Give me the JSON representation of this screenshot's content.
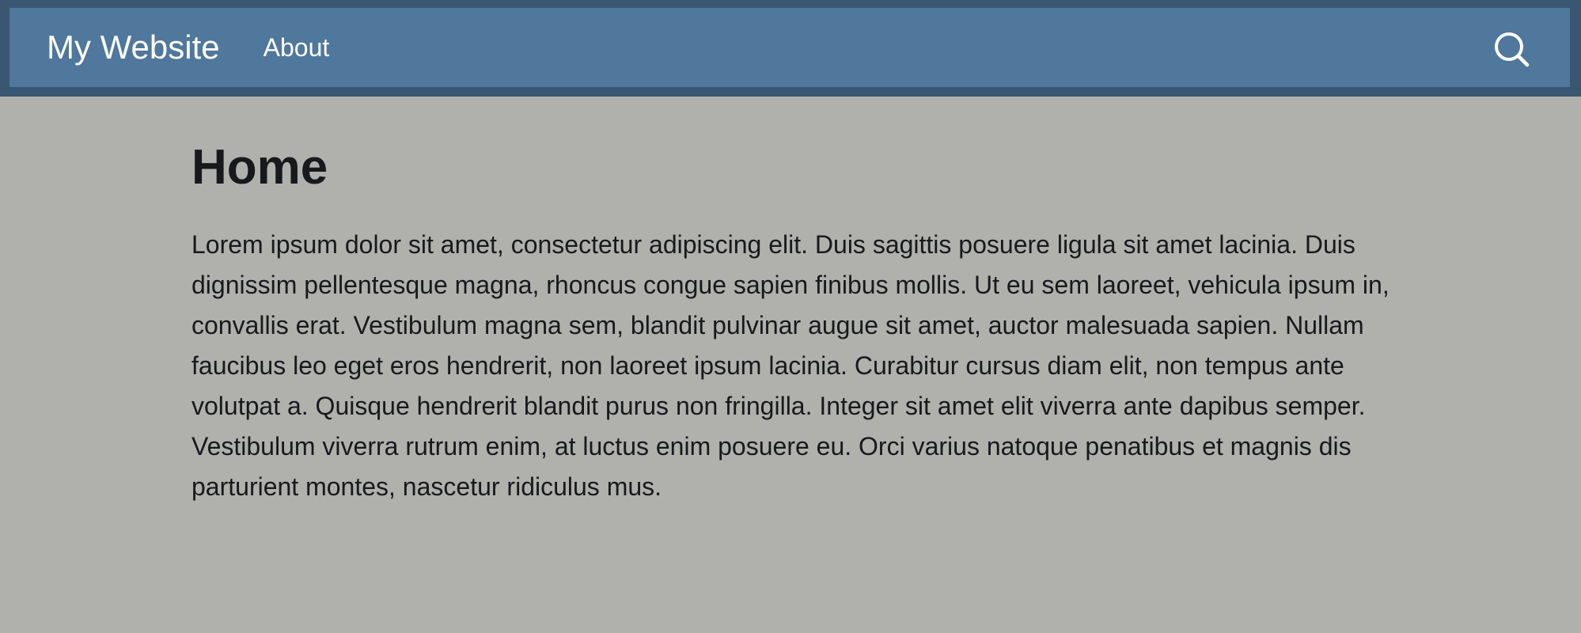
{
  "header": {
    "brand": "My Website",
    "nav_items": [
      {
        "label": "About"
      }
    ],
    "search_icon": "search-icon"
  },
  "main": {
    "title": "Home",
    "paragraph": "Lorem ipsum dolor sit amet, consectetur adipiscing elit. Duis sagittis posuere ligula sit amet lacinia. Duis dignissim pellentesque magna, rhoncus congue sapien finibus mollis. Ut eu sem laoreet, vehicula ipsum in, convallis erat. Vestibulum magna sem, blandit pulvinar augue sit amet, auctor malesuada sapien. Nullam faucibus leo eget eros hendrerit, non laoreet ipsum lacinia. Curabitur cursus diam elit, non tempus ante volutpat a. Quisque hendrerit blandit purus non fringilla. Integer sit amet elit viverra ante dapibus semper. Vestibulum viverra rutrum enim, at luctus enim posuere eu. Orci varius natoque penatibus et magnis dis parturient montes, nascetur ridiculus mus."
  },
  "colors": {
    "page_background": "#b0b1ad",
    "navbar_background": "#50779c",
    "navbar_border": "#3a5673",
    "text": "#17191c"
  }
}
